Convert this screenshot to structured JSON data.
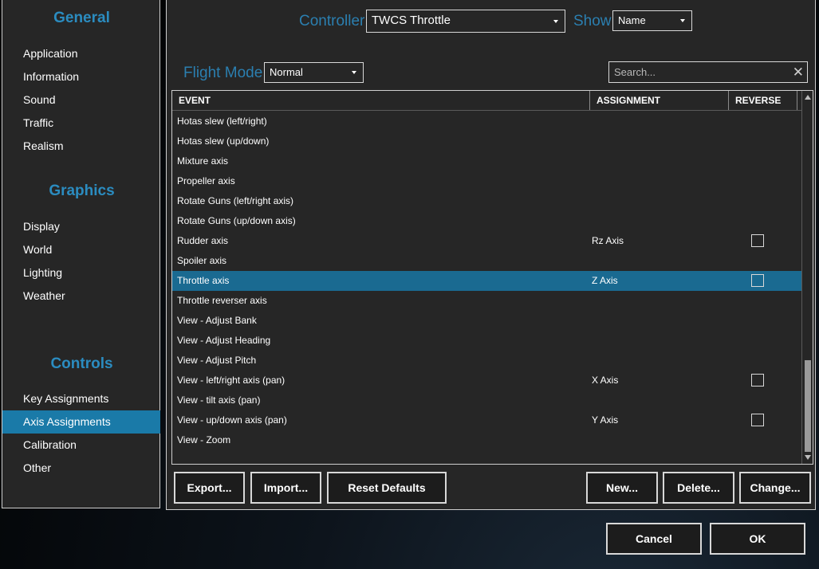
{
  "sidebar": {
    "sections": [
      {
        "title": "General",
        "items": [
          "Application",
          "Information",
          "Sound",
          "Traffic",
          "Realism"
        ]
      },
      {
        "title": "Graphics",
        "items": [
          "Display",
          "World",
          "Lighting",
          "Weather"
        ]
      },
      {
        "title": "Controls",
        "items": [
          "Key Assignments",
          "Axis Assignments",
          "Calibration",
          "Other"
        ]
      }
    ],
    "active_item": "Axis Assignments"
  },
  "header": {
    "controller_label": "Controller",
    "controller_value": "TWCS Throttle",
    "show_label": "Show",
    "show_value": "Name",
    "flight_mode_label": "Flight Mode",
    "flight_mode_value": "Normal",
    "search_placeholder": "Search...",
    "search_clear": "✕"
  },
  "table": {
    "columns": [
      "EVENT",
      "ASSIGNMENT",
      "REVERSE"
    ],
    "rows": [
      {
        "event": "Hotas slew (left/right)",
        "assignment": "",
        "reverse": null
      },
      {
        "event": "Hotas slew (up/down)",
        "assignment": "",
        "reverse": null
      },
      {
        "event": "Mixture axis",
        "assignment": "",
        "reverse": null
      },
      {
        "event": "Propeller axis",
        "assignment": "",
        "reverse": null
      },
      {
        "event": "Rotate Guns (left/right axis)",
        "assignment": "",
        "reverse": null
      },
      {
        "event": "Rotate Guns (up/down axis)",
        "assignment": "",
        "reverse": null
      },
      {
        "event": "Rudder axis",
        "assignment": "Rz Axis",
        "reverse": false
      },
      {
        "event": "Spoiler axis",
        "assignment": "",
        "reverse": null
      },
      {
        "event": "Throttle axis",
        "assignment": "Z Axis",
        "reverse": false,
        "selected": true
      },
      {
        "event": "Throttle reverser axis",
        "assignment": "",
        "reverse": null
      },
      {
        "event": "View - Adjust Bank",
        "assignment": "",
        "reverse": null
      },
      {
        "event": "View - Adjust Heading",
        "assignment": "",
        "reverse": null
      },
      {
        "event": "View - Adjust Pitch",
        "assignment": "",
        "reverse": null
      },
      {
        "event": "View - left/right axis (pan)",
        "assignment": "X Axis",
        "reverse": false
      },
      {
        "event": "View - tilt axis (pan)",
        "assignment": "",
        "reverse": null
      },
      {
        "event": "View - up/down axis (pan)",
        "assignment": "Y Axis",
        "reverse": false
      },
      {
        "event": "View - Zoom",
        "assignment": "",
        "reverse": null
      }
    ]
  },
  "buttons": {
    "export": "Export...",
    "import": "Import...",
    "reset": "Reset Defaults",
    "new": "New...",
    "delete": "Delete...",
    "change": "Change...",
    "cancel": "Cancel",
    "ok": "OK"
  },
  "colors": {
    "accent": "#2b8cc0",
    "selection": "#1a6a91",
    "panel": "#262626"
  }
}
